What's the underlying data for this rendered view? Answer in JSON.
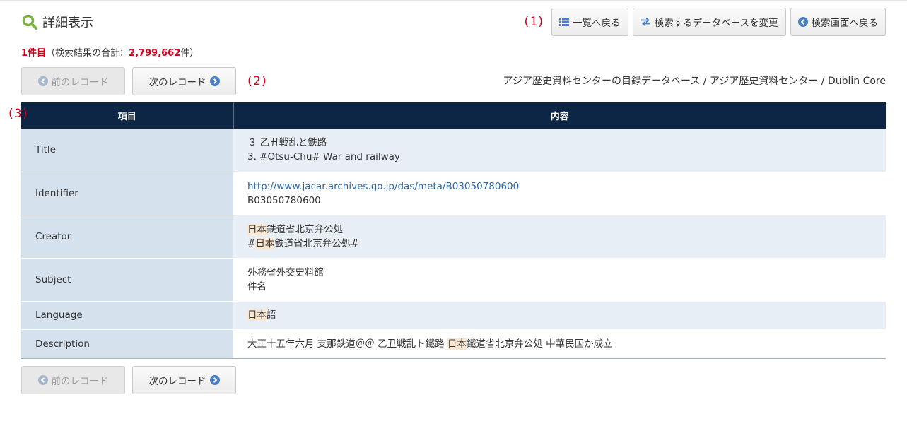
{
  "header": {
    "title": "詳細表示",
    "marker": "(1)",
    "buttons": {
      "back_to_list": "一覧へ戻る",
      "change_db": "検索するデータベースを変更",
      "back_to_search": "検索画面へ戻る"
    }
  },
  "result": {
    "current": "1件目",
    "prefix": "（検索結果の合計：",
    "total": "2,799,662",
    "suffix": "件）"
  },
  "nav": {
    "prev": "前のレコード",
    "next": "次のレコード",
    "marker": "(2)"
  },
  "database_path": "アジア歴史資料センターの目録データベース / アジア歴史資料センター / Dublin Core",
  "table": {
    "marker": "(3)",
    "headers": [
      "項目",
      "内容"
    ],
    "rows": [
      {
        "key": "Title",
        "lines": [
          "３ 乙丑戦乱と鉄路",
          "3. #Otsu-Chu# War and railway"
        ]
      },
      {
        "key": "Identifier",
        "link": "http://www.jacar.archives.go.jp/das/meta/B03050780600",
        "lines": [
          "B03050780600"
        ]
      },
      {
        "key": "Creator",
        "l1_hl": "日本",
        "l1_rest": "鉄道省北京弁公処",
        "l2_pre": "#",
        "l2_hl": "日本",
        "l2_rest": "鉄道省北京弁公処#"
      },
      {
        "key": "Subject",
        "lines": [
          "外務省外交史料館",
          "件名"
        ]
      },
      {
        "key": "Language",
        "hl": "日本",
        "rest": "語"
      },
      {
        "key": "Description",
        "pre": "大正十五年六月 支那鉄道＠＠ 乙丑戦乱ト鐵路 ",
        "hl": "日本",
        "rest": "鐵道省北京弁公処 中華民国か成立"
      }
    ]
  },
  "colors": {
    "accent": "#d0021b",
    "header_bg": "#0d2646",
    "key_bg": "#d5e2ed",
    "row_alt_bg": "#e8eef5",
    "highlight": "#fbe6cf",
    "link": "#2a68a8",
    "icon_green": "#7cb342",
    "icon_blue": "#4a7fc4"
  },
  "icons": [
    "search-icon",
    "list-icon",
    "swap-arrows-icon",
    "chevron-left-circle-icon",
    "chevron-right-circle-icon"
  ]
}
